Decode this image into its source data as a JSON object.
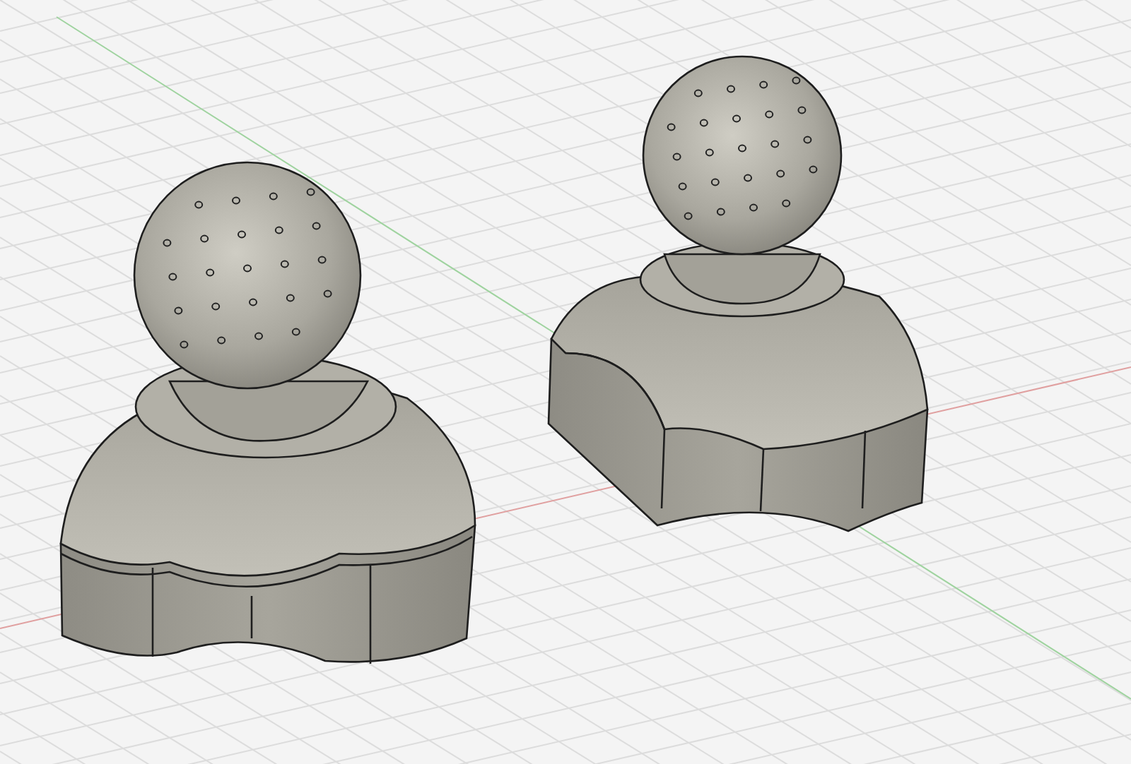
{
  "viewport": {
    "objects": [
      {
        "kind": "lobed"
      },
      {
        "kind": "boxy"
      }
    ]
  }
}
